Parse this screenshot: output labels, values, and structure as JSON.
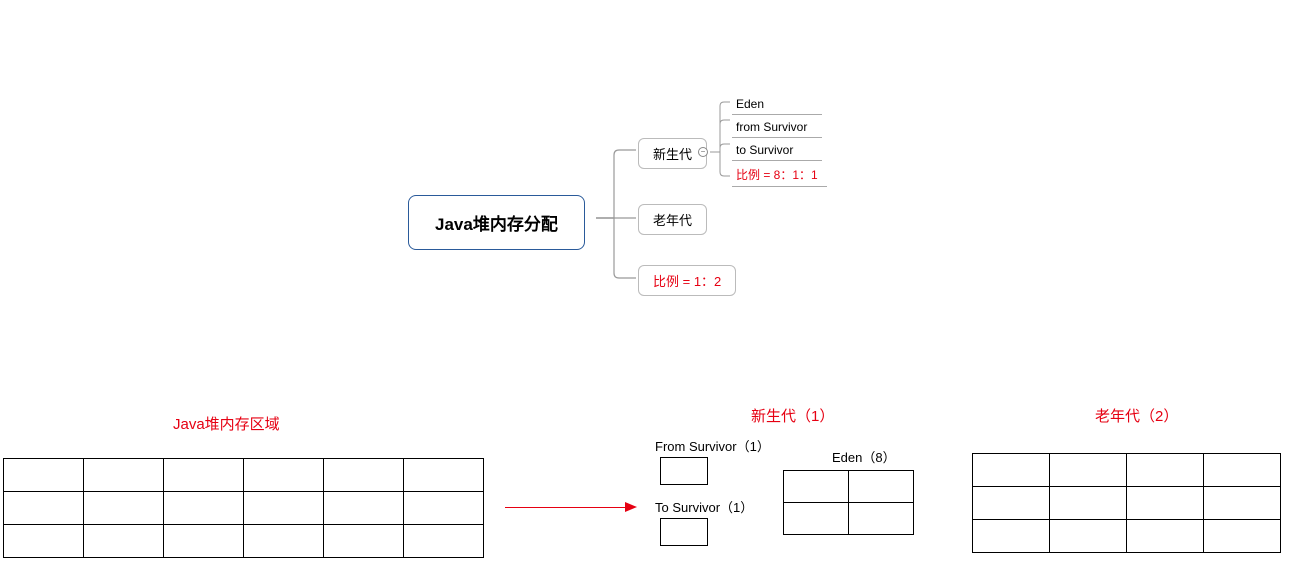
{
  "mindmap": {
    "root": "Java堆内存分配",
    "children": {
      "young": "新生代",
      "old": "老年代",
      "ratio": "比例 = 1：2"
    },
    "young_children": {
      "eden": "Eden",
      "from": "from Survivor",
      "to": "to Survivor",
      "ratio": "比例 = 8：1：1"
    }
  },
  "bottom": {
    "heap_title": "Java堆内存区域",
    "young_title": "新生代（1）",
    "old_title": "老年代（2）",
    "from_label": "From Survivor（1）",
    "to_label": "To Survivor（1）",
    "eden_label": "Eden（8）"
  }
}
